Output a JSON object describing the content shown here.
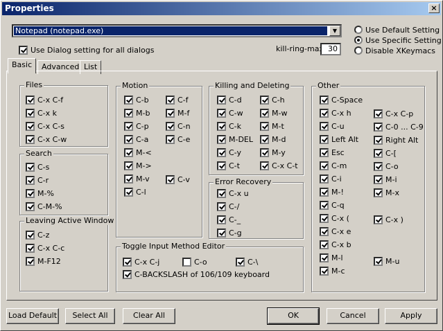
{
  "window": {
    "title": "Properties",
    "close_glyph": "×"
  },
  "app_select": {
    "value": "Notepad (notepad.exe)",
    "arrow": "▼"
  },
  "use_dialog": {
    "label": "Use Dialog setting for all dialogs",
    "checked": true
  },
  "kill_ring": {
    "label": "kill-ring-max:",
    "value": "30"
  },
  "modes": [
    {
      "label": "Use Default Setting",
      "on": false
    },
    {
      "label": "Use Specific Setting",
      "on": true
    },
    {
      "label": "Disable XKeymacs",
      "on": false
    }
  ],
  "tabs": [
    {
      "label": "Basic"
    },
    {
      "label": "Advanced"
    },
    {
      "label": "List"
    }
  ],
  "groups": {
    "files": {
      "title": "Files",
      "items": [
        "C-x C-f",
        "C-x k",
        "C-x C-s",
        "C-x C-w"
      ]
    },
    "search": {
      "title": "Search",
      "items": [
        "C-s",
        "C-r",
        "M-%",
        "C-M-%"
      ]
    },
    "leaving": {
      "title": "Leaving Active Window",
      "items": [
        "C-z",
        "C-x C-c",
        "M-F12"
      ]
    },
    "motion": {
      "title": "Motion",
      "col1": [
        "C-b",
        "M-b",
        "C-p",
        "C-a",
        "M-<",
        "M->",
        "M-v",
        "C-l"
      ],
      "col2": [
        "C-f",
        "M-f",
        "C-n",
        "C-e",
        "C-v"
      ]
    },
    "killing": {
      "title": "Killing and Deleting",
      "col1": [
        "C-d",
        "C-w",
        "C-k",
        "M-DEL",
        "C-y",
        "C-t"
      ],
      "col2": [
        "C-h",
        "M-w",
        "M-t",
        "M-d",
        "M-y",
        "C-x C-t"
      ]
    },
    "error": {
      "title": "Error Recovery",
      "items": [
        "C-x u",
        "C-/",
        "C-_",
        "C-g"
      ]
    },
    "toggle": {
      "title": "Toggle Input Method Editor",
      "items": [
        {
          "label": "C-x C-j",
          "checked": true
        },
        {
          "label": "C-o",
          "checked": false
        },
        {
          "label": "C-\\",
          "checked": true
        }
      ],
      "extra": "C-BACKSLASH of 106/109 keyboard"
    },
    "other": {
      "title": "Other",
      "col1": [
        "C-Space",
        "C-x h",
        "C-u",
        "Left Alt",
        "Esc",
        "C-m",
        "C-i",
        "M-!",
        "C-q",
        "C-x (",
        "C-x e",
        "C-x b",
        "M-l",
        "M-c"
      ],
      "col2": [
        "C-x C-p",
        "C-0 ... C-9",
        "Right Alt",
        "C-[",
        "C-o",
        "M-i",
        "M-x",
        "C-x )",
        "M-u"
      ]
    }
  },
  "buttons": {
    "load_default": "Load Default",
    "select_all": "Select All",
    "clear_all": "Clear All",
    "ok": "OK",
    "cancel": "Cancel",
    "apply": "Apply"
  }
}
